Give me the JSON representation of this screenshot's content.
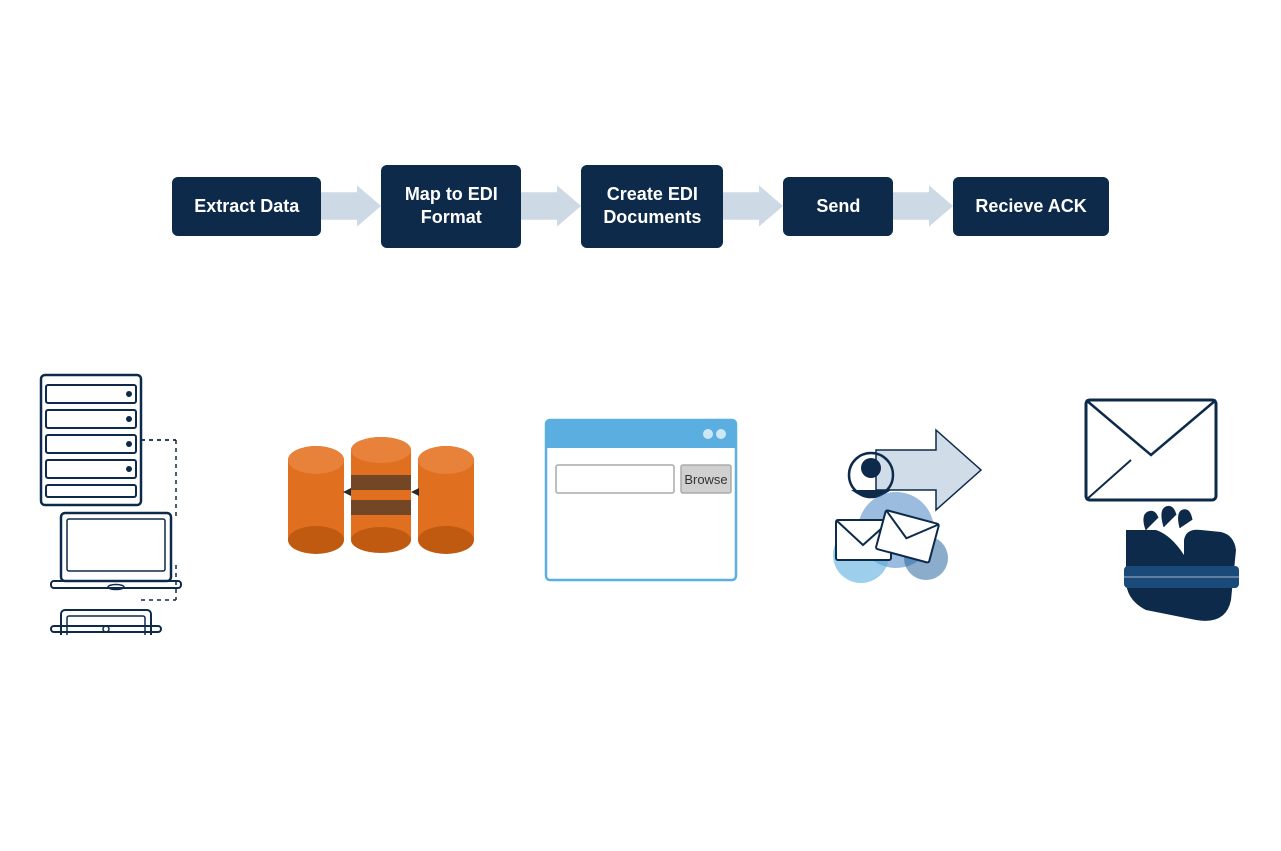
{
  "flow": {
    "steps": [
      {
        "id": "extract",
        "label": "Extract Data"
      },
      {
        "id": "map",
        "label": "Map to EDI\nFormat"
      },
      {
        "id": "create",
        "label": "Create EDI\nDocuments"
      },
      {
        "id": "send",
        "label": "Send"
      },
      {
        "id": "receive",
        "label": "Recieve ACK"
      }
    ],
    "arrow_color": "#d0dce8"
  },
  "colors": {
    "box_bg": "#0d2a4a",
    "box_text": "#ffffff",
    "arrow_fill": "#d0dce8",
    "orange": "#e07020",
    "blue_dark": "#0d2a4a",
    "blue_mid": "#3a7abf",
    "blue_light": "#5baee0"
  }
}
